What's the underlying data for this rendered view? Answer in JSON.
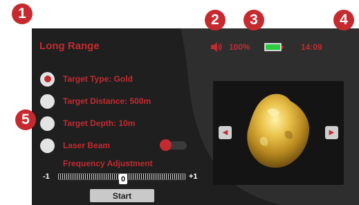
{
  "callouts": [
    "1",
    "2",
    "3",
    "4",
    "5"
  ],
  "header": {
    "title": "Long Range",
    "battery_percent": "100%",
    "battery_level": 1.0,
    "time": "14:09",
    "speaker_icon": "speaker-icon",
    "battery_icon": "battery-icon"
  },
  "options": [
    {
      "label": "Target Type: Gold",
      "selected": true
    },
    {
      "label": "Target Distance: 500m",
      "selected": false
    },
    {
      "label": "Target Depth: 10m",
      "selected": false
    },
    {
      "label": "Laser Beam",
      "selected": false,
      "toggle": "off"
    }
  ],
  "frequency": {
    "label": "Frequency Adjustment",
    "min_label": "-1",
    "max_label": "+1",
    "value": "0"
  },
  "start_label": "Start",
  "preview": {
    "image": "gold-nugget",
    "prev_icon": "chevron-left-icon",
    "next_icon": "chevron-right-icon"
  },
  "colors": {
    "accent": "#c22b31",
    "screen": "#1f1f1f",
    "panel": "#141414",
    "battery": "#2ecc40"
  }
}
